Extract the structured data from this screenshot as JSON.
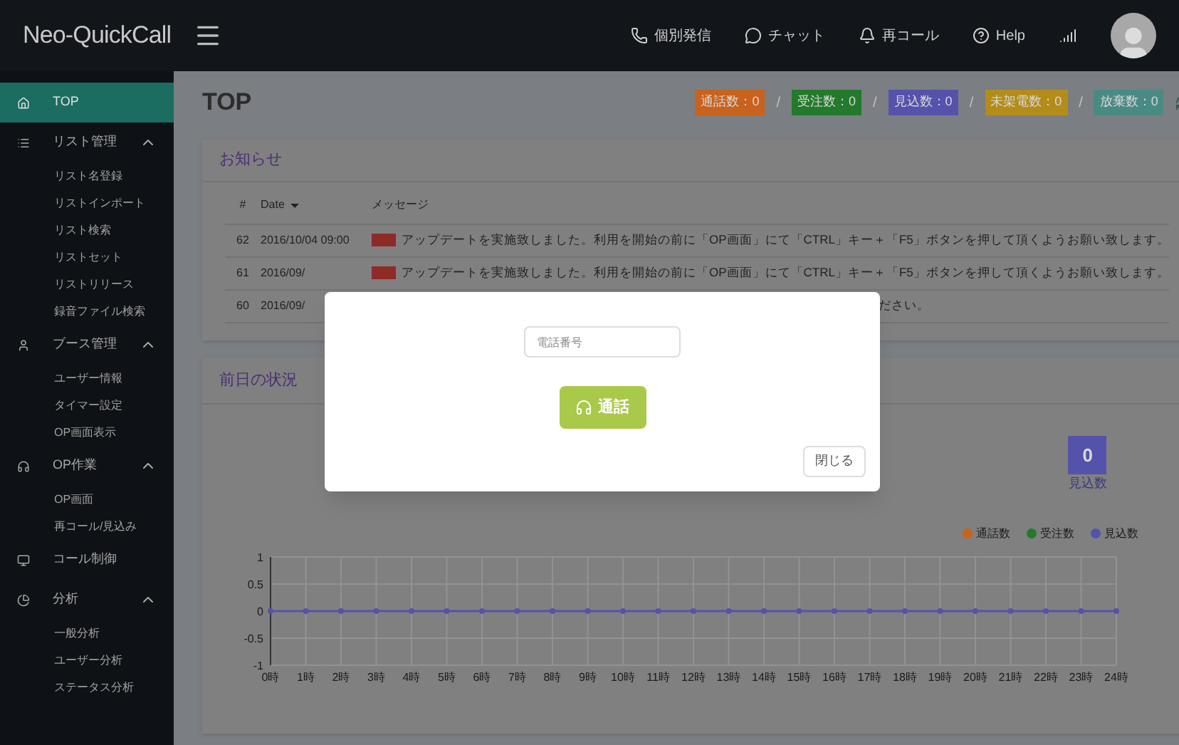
{
  "header": {
    "logo": "Neo-QuickCall",
    "links": [
      {
        "kind": "phone",
        "label": "個別発信"
      },
      {
        "kind": "chat",
        "label": "チャット"
      },
      {
        "kind": "bell",
        "label": "再コール"
      },
      {
        "kind": "help",
        "label": "Help"
      }
    ]
  },
  "sidebar": {
    "items": [
      {
        "kind": "home",
        "label": "TOP",
        "selected": true
      },
      {
        "kind": "list",
        "label": "リスト管理",
        "expanded": true,
        "children": [
          {
            "label": "リスト名登録"
          },
          {
            "label": "リストインポート"
          },
          {
            "label": "リスト検索"
          },
          {
            "label": "リストセット"
          },
          {
            "label": "リストリリース"
          },
          {
            "label": "録音ファイル検索"
          }
        ]
      },
      {
        "kind": "user",
        "label": "ブース管理",
        "expanded": true,
        "children": [
          {
            "label": "ユーザー情報"
          },
          {
            "label": "タイマー設定"
          },
          {
            "label": "OP画面表示"
          }
        ]
      },
      {
        "kind": "headphones",
        "label": "OP作業",
        "expanded": true,
        "children": [
          {
            "label": "OP画面"
          },
          {
            "label": "再コール/見込み"
          }
        ]
      },
      {
        "kind": "monitor",
        "label": "コール制御",
        "selected": false
      },
      {
        "kind": "pie",
        "label": "分析",
        "expanded": true,
        "children": [
          {
            "label": "一般分析"
          },
          {
            "label": "ユーザー分析"
          },
          {
            "label": "ステータス分析"
          }
        ]
      }
    ]
  },
  "page_title": "TOP",
  "counters": [
    {
      "label": "通話数：0",
      "color": "#c8621c"
    },
    {
      "separator": "/",
      "label": "受注数：0",
      "color": "#237a2c"
    },
    {
      "separator": "/",
      "label": "見込数：0",
      "color": "#5552ac"
    },
    {
      "separator": "/",
      "label": "未架電数：0",
      "color": "#b48c1a"
    },
    {
      "separator": "/",
      "label": "放棄数：0",
      "color": "#4a8a85"
    }
  ],
  "notices": {
    "title": "お知らせ",
    "columns": [
      "#",
      "Date",
      "メッセージ"
    ],
    "rows": [
      {
        "no": "62",
        "date": "2016/10/04 09:00",
        "message": "アップデートを実施致しました。利用を開始の前に「OP画面」にて「CTRL」キー＋「F5」ボタンを押して頂くようお願い致します。",
        "covered": false
      },
      {
        "no": "61",
        "date": "2016/09/",
        "message": "アップデートを実施致しました。利用を開始の前に「OP画面」にて「CTRL」キー＋「F5」ボタンを押して頂くようお願い致します。",
        "covered": false
      },
      {
        "no": "60",
        "date": "2016/09/",
        "message": "ださい。",
        "covered": true
      }
    ]
  },
  "yesterday": {
    "title": "前日の状況",
    "stats": [
      {
        "value": "0",
        "label": "見込数",
        "color": "#5552ac"
      }
    ],
    "chart_data": {
      "type": "line",
      "grid": true,
      "categories": [
        "0時",
        "1時",
        "2時",
        "3時",
        "4時",
        "5時",
        "6時",
        "7時",
        "8時",
        "9時",
        "10時",
        "11時",
        "12時",
        "13時",
        "14時",
        "15時",
        "16時",
        "17時",
        "18時",
        "19時",
        "20時",
        "21時",
        "22時",
        "23時",
        "24時"
      ],
      "ylim": [
        -1,
        1
      ],
      "yticks": [
        -1,
        -0.5,
        0,
        0.5,
        1
      ],
      "series": [
        {
          "name": "通話数",
          "color": "#c8621c",
          "marker": true,
          "values": [
            null,
            null,
            null,
            null,
            null,
            null,
            null,
            null,
            null,
            null,
            null,
            null,
            null,
            null,
            null,
            null,
            null,
            null,
            null,
            null,
            null,
            null,
            null,
            null,
            null
          ]
        },
        {
          "name": "受注数",
          "color": "#237a2c",
          "marker": true,
          "values": [
            null,
            null,
            null,
            null,
            null,
            null,
            null,
            null,
            null,
            null,
            null,
            null,
            null,
            null,
            null,
            null,
            null,
            null,
            null,
            null,
            null,
            null,
            null,
            null,
            null
          ]
        },
        {
          "name": "見込数",
          "color": "#5552ac",
          "marker": true,
          "values": [
            0,
            0,
            0,
            0,
            0,
            0,
            0,
            0,
            0,
            0,
            0,
            0,
            0,
            0,
            0,
            0,
            0,
            0,
            0,
            0,
            0,
            0,
            0,
            0,
            0
          ]
        }
      ]
    }
  },
  "dialog": {
    "phone_placeholder": "電話番号",
    "call_button": "通話",
    "close_button": "閉じる"
  }
}
